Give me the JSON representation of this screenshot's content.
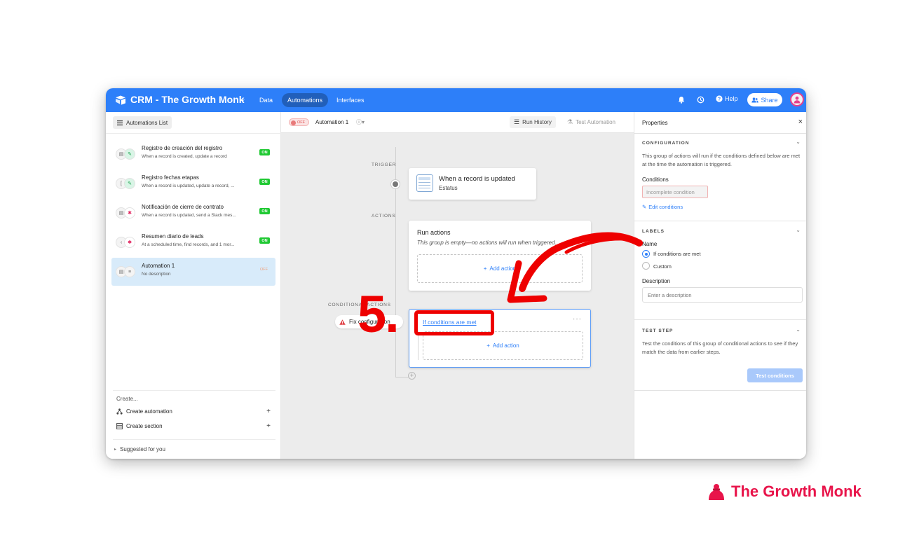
{
  "app": {
    "base_title": "CRM - The Growth Monk",
    "nav_tabs": [
      "Data",
      "Automations",
      "Interfaces"
    ],
    "active_tab": "Automations",
    "help_label": "Help",
    "share_label": "Share",
    "accent_color": "#2d7ff9"
  },
  "sidebar": {
    "header_label": "Automations List",
    "items": [
      {
        "title": "Registro de creación del registro",
        "desc": "When a record is created, update a record",
        "status": "ON"
      },
      {
        "title": "Registro fechas etapas",
        "desc": "When a record is updated, update a record, ...",
        "status": "ON"
      },
      {
        "title": "Notificación de cierre de contrato",
        "desc": "When a record is updated, send a Slack mes...",
        "status": "ON"
      },
      {
        "title": "Resumen diario de leads",
        "desc": "At a scheduled time, find records, and 1 mor...",
        "status": "ON"
      },
      {
        "title": "Automation 1",
        "desc": "No description",
        "status": "OFF"
      }
    ],
    "create_label": "Create...",
    "create_automation": "Create automation",
    "create_section": "Create section",
    "suggested": "Suggested for you"
  },
  "canvas": {
    "toggle_label": "OFF",
    "automation_name": "Automation 1",
    "run_history": "Run History",
    "test_automation": "Test Automation",
    "trigger_label": "TRIGGER",
    "actions_label": "ACTIONS",
    "conditional_label": "CONDITIONAL ACTIONS",
    "trigger_title": "When a record is updated",
    "trigger_sub": "Estatus",
    "run_actions_title": "Run actions",
    "run_actions_empty": "This group is empty—no actions will run when triggered.",
    "add_action": "Add action",
    "fix_pill": "Fix configuration",
    "conditions_link": "If conditions are met",
    "conditions_menu": "···"
  },
  "properties": {
    "title": "Properties",
    "configuration_heading": "CONFIGURATION",
    "configuration_text": "This group of actions will run if the conditions defined below are met at the time the automation is triggered.",
    "conditions_label": "Conditions",
    "incomplete_condition": "Incomplete condition",
    "edit_conditions": "Edit conditions",
    "labels_heading": "LABELS",
    "name_label": "Name",
    "radio_options": [
      "If conditions are met",
      "Custom"
    ],
    "description_label": "Description",
    "description_placeholder": "Enter a description",
    "test_step_heading": "TEST STEP",
    "test_step_text": "Test the conditions of this group of conditional actions to see if they match the data from earlier steps.",
    "test_button": "Test conditions"
  },
  "annotation": {
    "step_number": "5.",
    "color": "#ee0000"
  },
  "brand": {
    "name": "The Growth Monk",
    "color": "#e8144a"
  }
}
